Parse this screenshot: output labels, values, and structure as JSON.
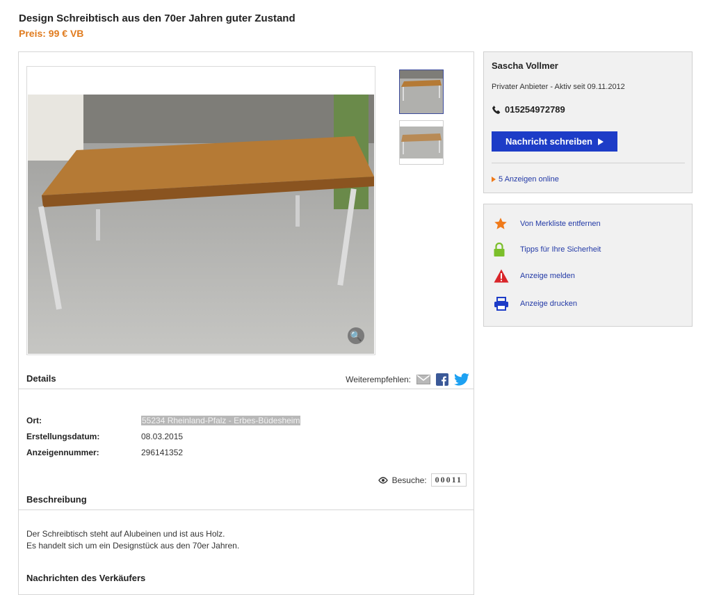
{
  "listing": {
    "title": "Design Schreibtisch aus den 70er Jahren guter Zustand",
    "price": "Preis: 99 € VB"
  },
  "details": {
    "heading": "Details",
    "share_label": "Weiterempfehlen:",
    "rows": [
      {
        "key": "Ort:",
        "value": "55234 Rheinland-Pfalz - Erbes-Büdesheim"
      },
      {
        "key": "Erstellungsdatum:",
        "value": "08.03.2015"
      },
      {
        "key": "Anzeigennummer:",
        "value": "296141352"
      }
    ],
    "visits_label": "Besuche:",
    "visits_count": "00011"
  },
  "description": {
    "heading": "Beschreibung",
    "lines": [
      "Der Schreibtisch steht auf Alubeinen und ist aus Holz.",
      "Es handelt sich um ein Designstück aus den 70er Jahren."
    ],
    "next_heading": "Nachrichten des Verkäufers"
  },
  "seller": {
    "name": "Sascha Vollmer",
    "since": "Privater Anbieter - Aktiv seit 09.11.2012",
    "phone": "015254972789",
    "message_button": "Nachricht schreiben",
    "more_ads": "5 Anzeigen online"
  },
  "actions": [
    {
      "label": "Von Merkliste entfernen",
      "icon": "star-icon"
    },
    {
      "label": "Tipps für Ihre Sicherheit",
      "icon": "lock-icon"
    },
    {
      "label": "Anzeige melden",
      "icon": "warning-icon"
    },
    {
      "label": "Anzeige drucken",
      "icon": "printer-icon"
    }
  ],
  "colors": {
    "price": "#e07b1e",
    "button": "#1d3cc7",
    "link": "#2239a6",
    "star": "#f07a1a",
    "lock": "#7bbf2a",
    "warning": "#d9262a",
    "printer": "#1d3cc7"
  }
}
